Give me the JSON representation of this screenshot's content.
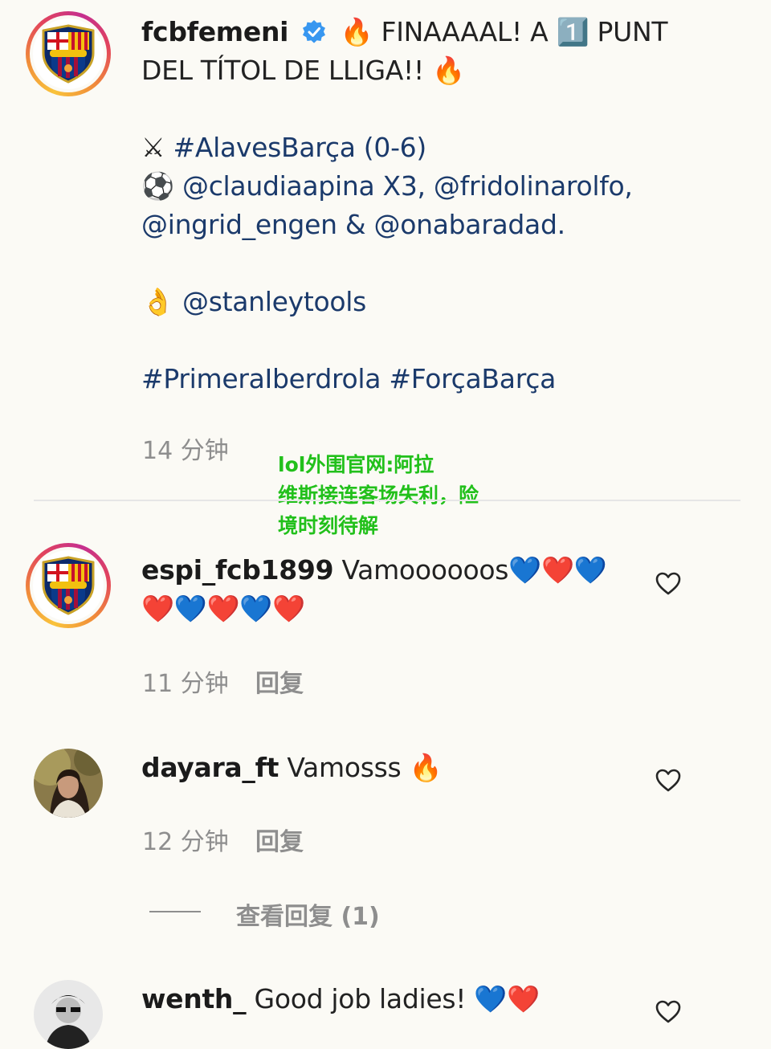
{
  "post": {
    "username": "fcbfemeni",
    "verified": true,
    "caption_line1": "🔥 FINAAAAL! A 1️⃣ PUNT",
    "caption_line2": "DEL TÍTOL DE LLIGA!! 🔥",
    "caption_match_icon": "⚔",
    "caption_match": "#AlavesBarça (0-6)",
    "caption_goals_icon": "⚽",
    "caption_goals_a": "@claudiaapina X3, @fridolinarolfo,",
    "caption_goals_b": "@ingrid_engen & @onabaradad.",
    "caption_sponsor_icon": "👌",
    "caption_sponsor": "@stanleytools",
    "caption_tags": "#PrimeraIberdrola #ForçaBarça",
    "time": "14 分钟"
  },
  "overlay": {
    "line1": "lol外围官网:阿拉",
    "line2": "维斯接连客场失利，险",
    "line3": "境时刻待解"
  },
  "comments": [
    {
      "username": "espi_fcb1899",
      "text_line1": "Vamoooooos💙❤️💙",
      "text_line2": "❤️💙❤️💙❤️",
      "time": "11 分钟",
      "reply_label": "回复"
    },
    {
      "username": "dayara_ft",
      "text_line1": "Vamosss 🔥",
      "time": "12 分钟",
      "reply_label": "回复",
      "view_replies": "查看回复 (1)"
    },
    {
      "username": "wenth_",
      "text_line1": "Good job ladies! 💙❤️"
    }
  ],
  "colors": {
    "background": "#fbfaf5",
    "overlay_text": "#22c01b",
    "meta_text": "#8e8e8e",
    "verified_badge": "#3897f0"
  },
  "icons": {
    "heart": "heart-outline-icon",
    "verified": "verified-badge-icon"
  }
}
